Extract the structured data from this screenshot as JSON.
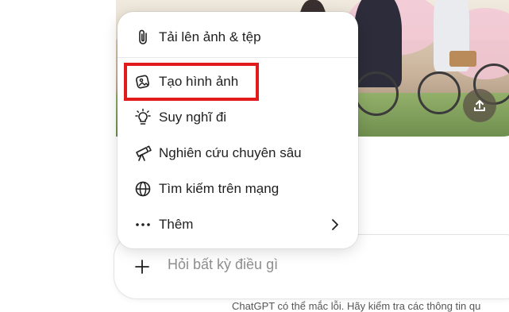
{
  "menu": {
    "items": [
      {
        "label": "Tải lên ảnh & tệp",
        "icon": "paperclip-icon"
      },
      {
        "label": "Tạo hình ảnh",
        "icon": "image-create-icon"
      },
      {
        "label": "Suy nghĩ đi",
        "icon": "lightbulb-icon"
      },
      {
        "label": "Nghiên cứu chuyên sâu",
        "icon": "telescope-icon"
      },
      {
        "label": "Tìm kiếm trên mạng",
        "icon": "globe-icon"
      },
      {
        "label": "Thêm",
        "icon": "more-icon",
        "has_submenu": true
      }
    ]
  },
  "composer": {
    "placeholder": "Hỏi bất kỳ điều gì"
  },
  "footer": {
    "disclaimer": "ChatGPT có thể mắc lỗi. Hãy kiểm tra các thông tin qu"
  },
  "colors": {
    "highlight": "#e11b1b",
    "menu_bg": "#ffffff",
    "text": "#1f1f1f",
    "placeholder": "#8e8e8e"
  }
}
